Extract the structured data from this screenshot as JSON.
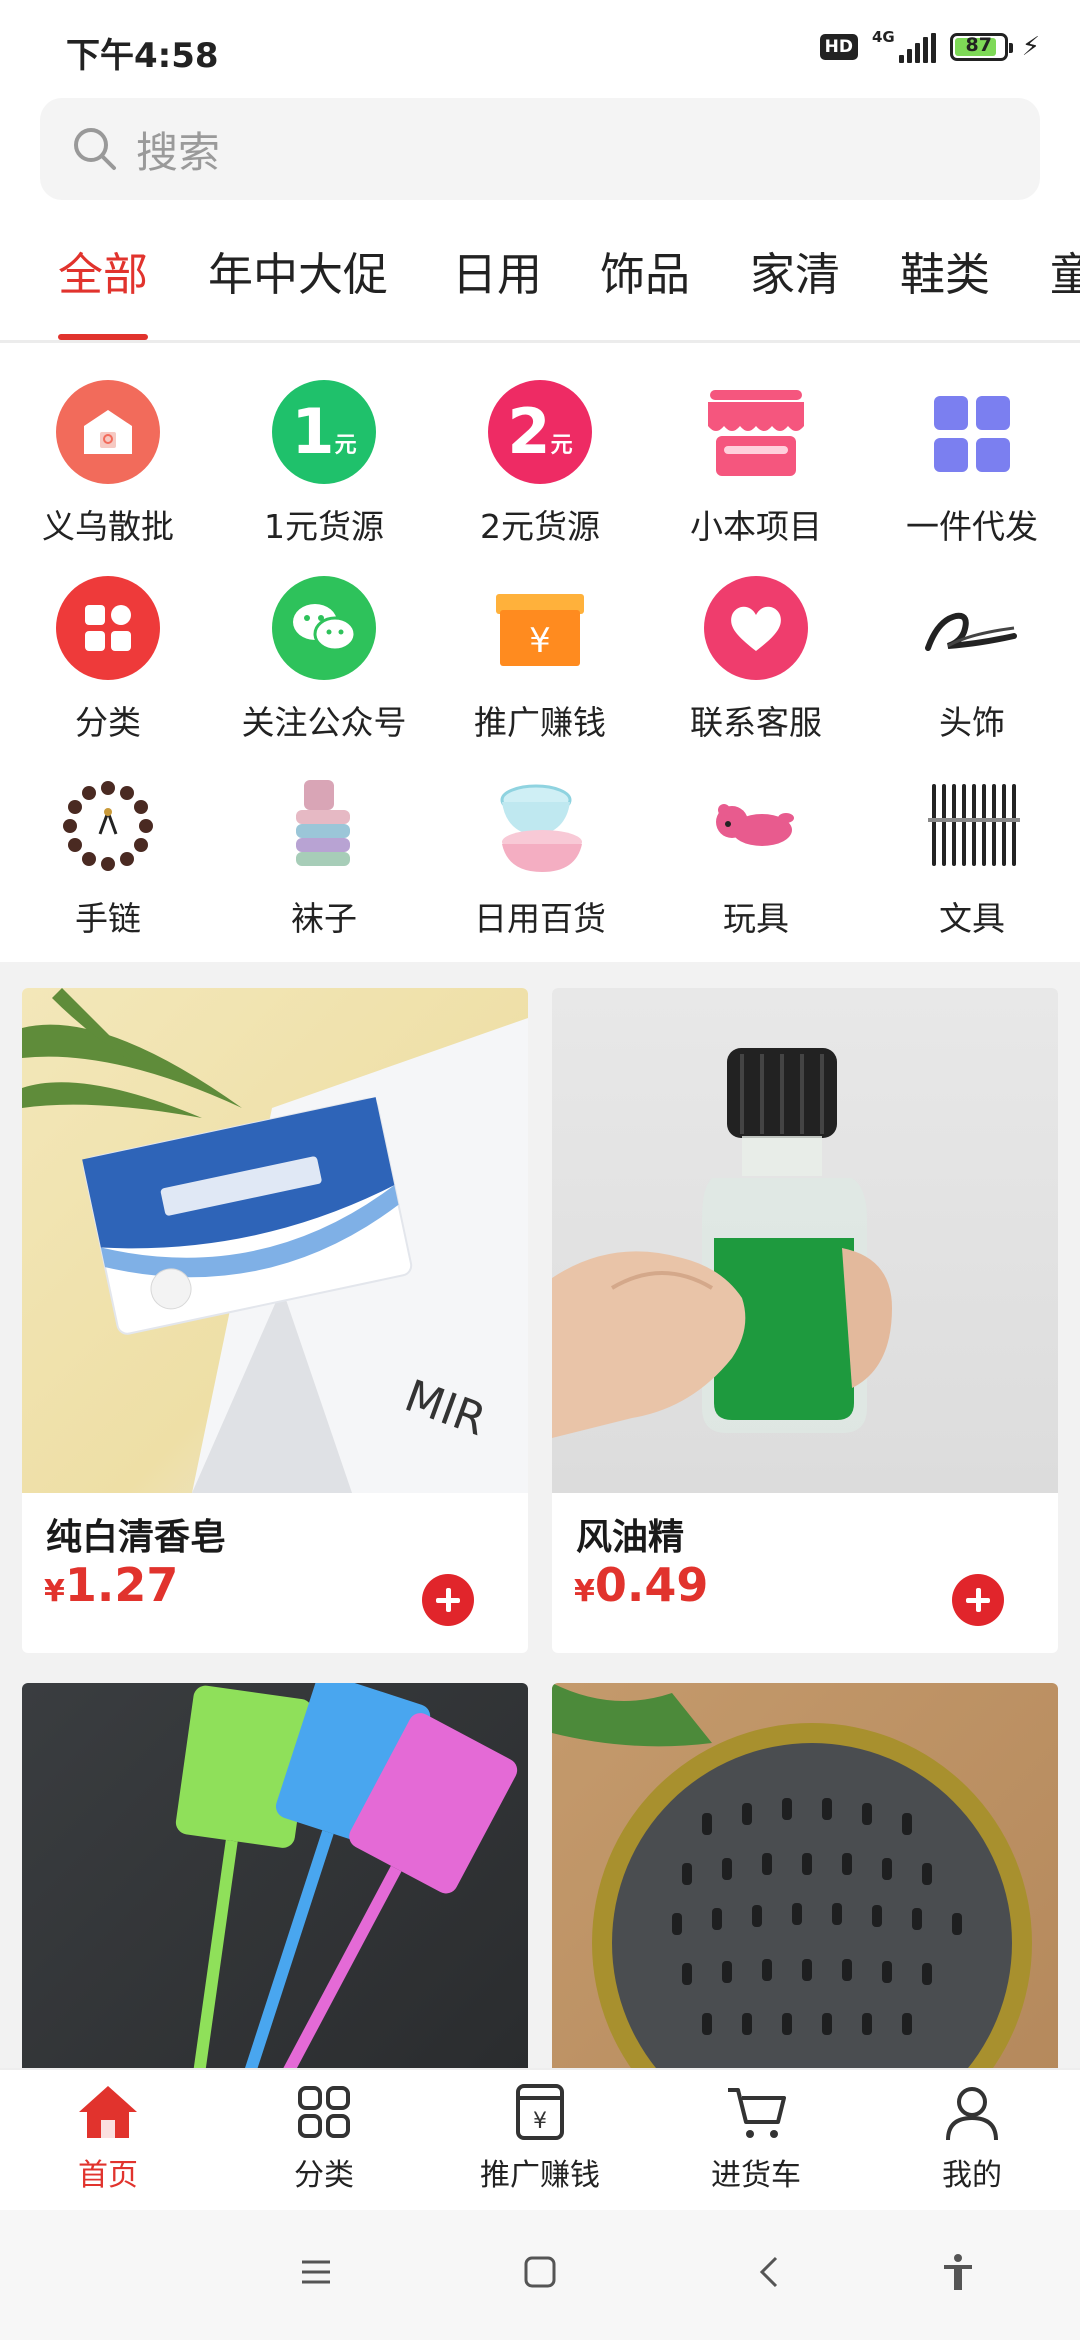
{
  "status": {
    "time": "下午4:58",
    "hd": "HD",
    "network": "4G",
    "battery": "87"
  },
  "search": {
    "placeholder": "搜索"
  },
  "tabs": [
    {
      "label": "全部"
    },
    {
      "label": "年中大促"
    },
    {
      "label": "日用"
    },
    {
      "label": "饰品"
    },
    {
      "label": "家清"
    },
    {
      "label": "鞋类"
    },
    {
      "label": "童"
    }
  ],
  "icon_grid": [
    {
      "label": "义乌散批",
      "icon": "store-icon",
      "color": "#f26b5b"
    },
    {
      "label": "1元货源",
      "icon": "one-yuan-icon",
      "color": "#1fc16b",
      "badge": "1",
      "unit": "元"
    },
    {
      "label": "2元货源",
      "icon": "two-yuan-icon",
      "color": "#ee2b64",
      "badge": "2",
      "unit": "元"
    },
    {
      "label": "小本项目",
      "icon": "shop-awning-icon",
      "color": "#f5567e"
    },
    {
      "label": "一件代发",
      "icon": "grid-four-icon",
      "color": "#7b7ff0"
    },
    {
      "label": "分类",
      "icon": "category-icon",
      "color": "#ee3a3a"
    },
    {
      "label": "关注公众号",
      "icon": "wechat-icon",
      "color": "#2ec25b"
    },
    {
      "label": "推广赚钱",
      "icon": "promote-box-icon",
      "color": "#ff8b1f",
      "glyph": "¥"
    },
    {
      "label": "联系客服",
      "icon": "heart-service-icon",
      "color": "#ef3d6d"
    },
    {
      "label": "头饰",
      "icon": "hair-clip-icon",
      "color": "#222222"
    },
    {
      "label": "手链",
      "icon": "bracelet-icon",
      "color": "#4a2a22"
    },
    {
      "label": "袜子",
      "icon": "socks-icon",
      "color": "#c9a7b8"
    },
    {
      "label": "日用百货",
      "icon": "basin-icon",
      "color": "#8fd3e0"
    },
    {
      "label": "玩具",
      "icon": "toy-icon",
      "color": "#e85b8e"
    },
    {
      "label": "文具",
      "icon": "pens-icon",
      "color": "#222222"
    }
  ],
  "products": [
    {
      "name": "纯白清香皂",
      "currency": "¥",
      "price": "1.27",
      "image": "soap-image"
    },
    {
      "name": "风油精",
      "currency": "¥",
      "price": "0.49",
      "image": "oil-bottle-image"
    },
    {
      "name": "",
      "currency": "",
      "price": "",
      "image": "fly-swatter-image"
    },
    {
      "name": "",
      "currency": "",
      "price": "",
      "image": "drain-cover-image"
    }
  ],
  "bottom_nav": [
    {
      "label": "首页",
      "icon": "home-icon",
      "active": true
    },
    {
      "label": "分类",
      "icon": "category-grid-icon"
    },
    {
      "label": "推广赚钱",
      "icon": "promote-icon"
    },
    {
      "label": "进货车",
      "icon": "cart-icon"
    },
    {
      "label": "我的",
      "icon": "profile-icon"
    }
  ],
  "colors": {
    "accent": "#e1332d",
    "page_bg": "#f2f2f2"
  }
}
